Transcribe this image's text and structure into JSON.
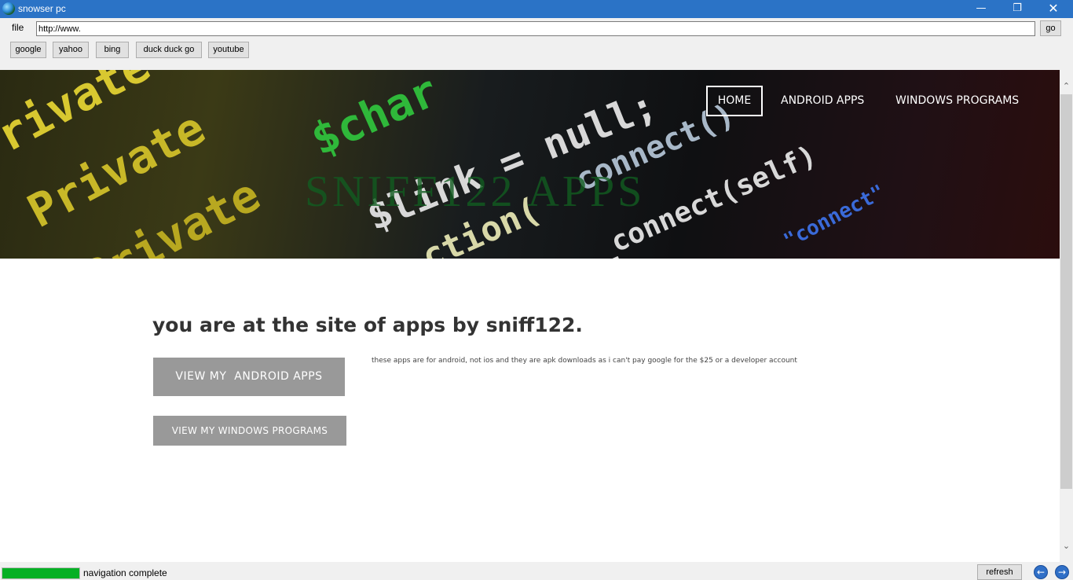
{
  "window": {
    "title": "snowser pc",
    "minimize_glyph": "—",
    "maximize_glyph": "❐",
    "close_glyph": "✕"
  },
  "menu": {
    "file": "file"
  },
  "address_bar": {
    "value": "http://www.",
    "go_label": "go"
  },
  "bookmarks": [
    "google",
    "yahoo",
    "bing",
    "duck duck go",
    "youtube"
  ],
  "site": {
    "hero_title": "SNIFF122 APPS",
    "nav": {
      "home": "HOME",
      "android": "ANDROID APPS",
      "windows": "WINDOWS PROGRAMS"
    },
    "heading": "you are at the site of apps by sniff122.",
    "btn_android": "VIEW MY  ANDROID APPS",
    "btn_windows": "VIEW MY WINDOWS PROGRAMS",
    "description": "these apps are for android, not ios and they are apk downloads as i can't pay google for the $25 or a developer account"
  },
  "hero_code": [
    "Private",
    "Private",
    "Private",
    "$char",
    "$link = null;",
    "connect()",
    "ction(",
    "_connect(self)",
    "\"connect\""
  ],
  "status": {
    "text": "navigation complete",
    "progress": 1.0,
    "refresh_label": "refresh"
  },
  "colors": {
    "titlebar": "#2b73c6",
    "progress": "#06b025",
    "button_grey": "#999999"
  }
}
